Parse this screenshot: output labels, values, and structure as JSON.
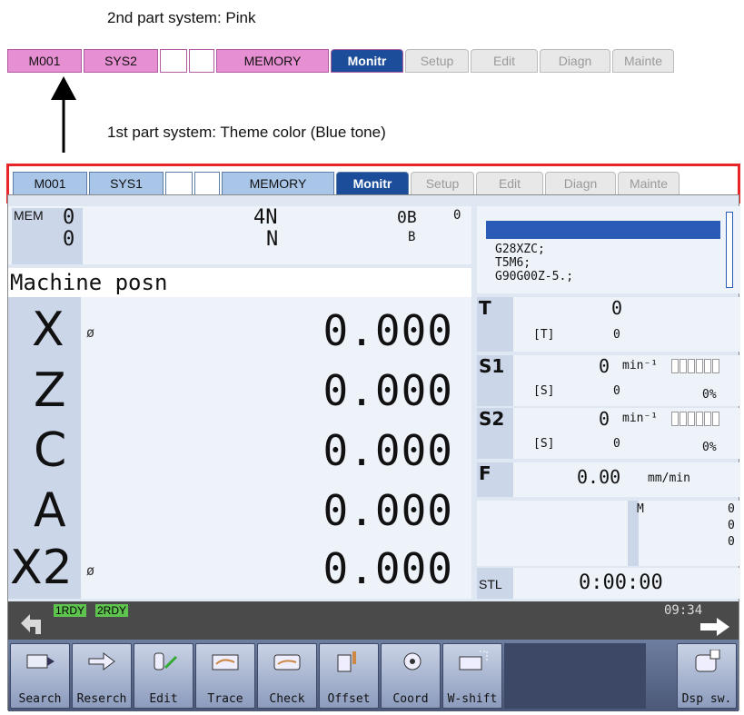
{
  "captions": {
    "second_system": "2nd part system: Pink",
    "first_system": "1st part system: Theme color (Blue tone)"
  },
  "pink_bar": {
    "mode": "M001",
    "sys": "SYS2",
    "op": "MEMORY",
    "tabs": [
      "Monitr",
      "Setup",
      "Edit",
      "Diagn",
      "Mainte"
    ],
    "color": "#e78fd3"
  },
  "blue_bar": {
    "mode": "M001",
    "sys": "SYS1",
    "op": "MEMORY",
    "tabs": [
      "Monitr",
      "Setup",
      "Edit",
      "Diagn",
      "Mainte"
    ],
    "color": "#a9c6e8"
  },
  "highlight_color": "#e8262a",
  "active_tab_color": "#1c4d9a",
  "program": {
    "mem": "MEM",
    "o1": "0",
    "o2": "0",
    "n1": "4N",
    "n2": "N",
    "b1": "0B",
    "b2": "B",
    "b_val": "0"
  },
  "program_lines": [
    "G28XZC;",
    "T5M6;",
    "G90G00Z-5.;"
  ],
  "position": {
    "title": "Machine posn",
    "axes": [
      {
        "name": "X",
        "dia": "ø",
        "value": "0.000"
      },
      {
        "name": "Z",
        "dia": "",
        "value": "0.000"
      },
      {
        "name": "C",
        "dia": "",
        "value": "0.000"
      },
      {
        "name": "A",
        "dia": "",
        "value": "0.000"
      },
      {
        "name": "X2",
        "dia": "ø",
        "value": "0.000"
      }
    ]
  },
  "tool": {
    "label": "T",
    "value": "0",
    "sub_label": "[T]",
    "sub_value": "0"
  },
  "spindle1": {
    "label": "S1",
    "value": "0",
    "unit": "min⁻¹",
    "sub_label": "[S]",
    "sub_value": "0",
    "load": "0%"
  },
  "spindle2": {
    "label": "S2",
    "value": "0",
    "unit": "min⁻¹",
    "sub_label": "[S]",
    "sub_value": "0",
    "load": "0%"
  },
  "feed": {
    "label": "F",
    "value": "0.00",
    "unit": "mm/min"
  },
  "mcodes": {
    "label": "M",
    "values": [
      "0",
      "0",
      "0"
    ]
  },
  "stl": {
    "label": "STL",
    "value": "0:00:00"
  },
  "status": {
    "rdy1": "1RDY",
    "rdy2": "2RDY",
    "time": "09:34"
  },
  "softkeys": [
    "Search",
    "Reserch",
    "Edit",
    "Trace",
    "Check",
    "Offset",
    "Coord",
    "W-shift",
    "",
    "Dsp sw."
  ]
}
